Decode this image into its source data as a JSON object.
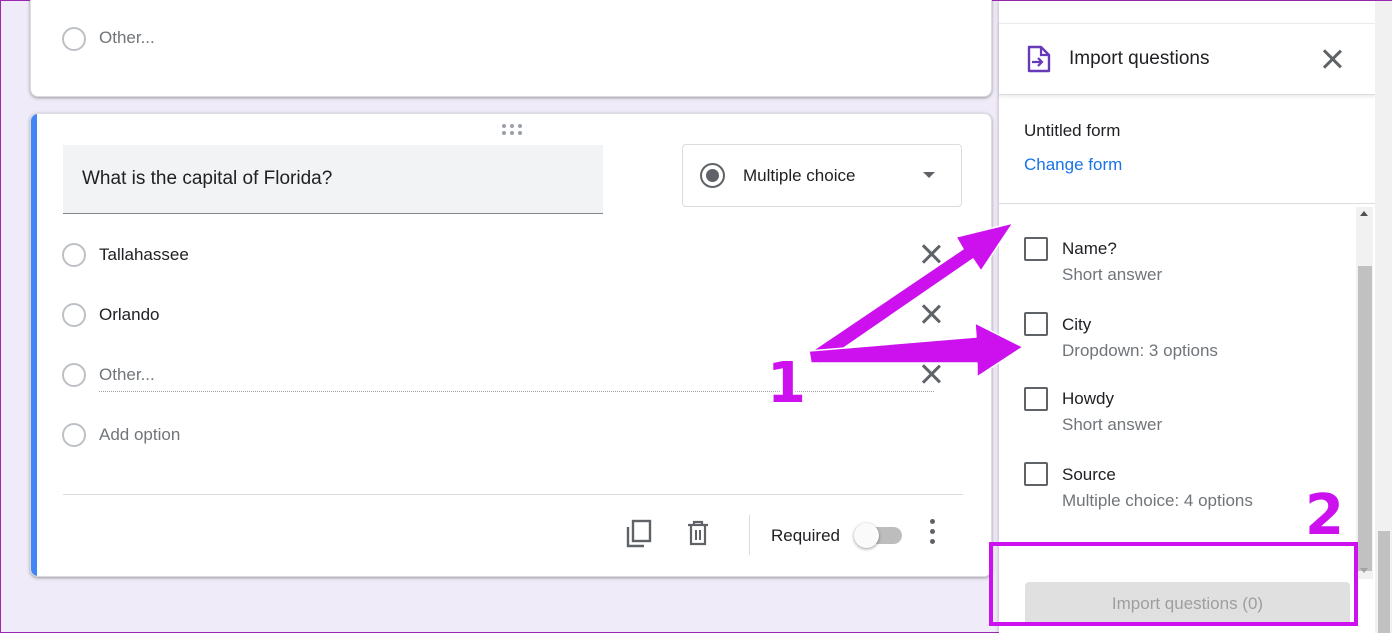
{
  "top_card": {
    "other_option": "Other..."
  },
  "question": {
    "title": "What is the capital of Florida?",
    "type_label": "Multiple choice",
    "options": [
      "Tallahassee",
      "Orlando"
    ],
    "other_option": "Other...",
    "add_option": "Add option",
    "required_label": "Required",
    "required_on": false
  },
  "import_panel": {
    "title": "Import questions",
    "form_name": "Untitled form",
    "change_form": "Change form",
    "items": [
      {
        "title": "Name?",
        "subtitle": "Short answer"
      },
      {
        "title": "City",
        "subtitle": "Dropdown: 3 options"
      },
      {
        "title": "Howdy",
        "subtitle": "Short answer"
      },
      {
        "title": "Source",
        "subtitle": "Multiple choice: 4 options"
      }
    ],
    "import_button": "Import questions (0)"
  },
  "annotations": {
    "step1": "1",
    "step2": "2",
    "color": "#cc11ee"
  },
  "colors": {
    "background": "#f0ebf8",
    "accent_blue": "#4285f4",
    "link_blue": "#1a73e8",
    "panel_icon_purple": "#673ab7"
  },
  "icons": [
    "drag-handle-icon",
    "radio-selected-icon",
    "dropdown-caret-icon",
    "close-icon",
    "duplicate-icon",
    "delete-icon",
    "more-vert-icon",
    "import-file-icon"
  ]
}
